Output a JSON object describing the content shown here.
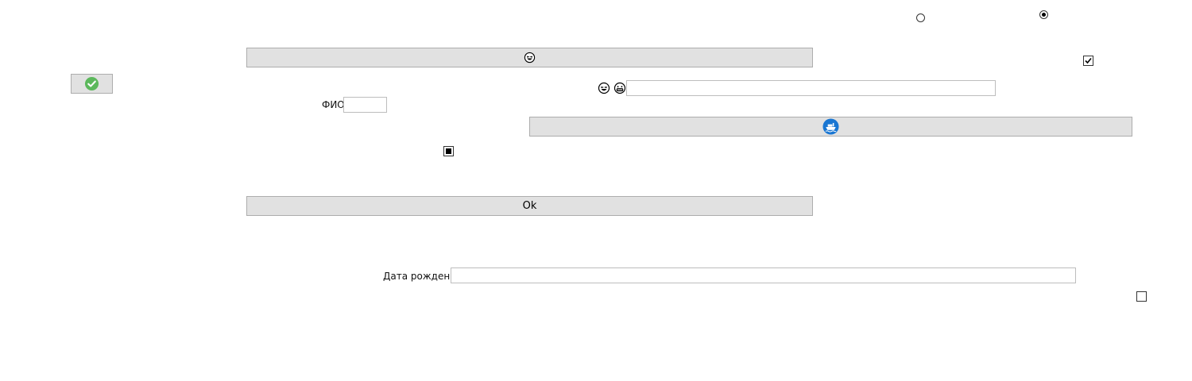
{
  "radio_group": {
    "options": [
      {
        "name": "radio-option-1",
        "selected": false
      },
      {
        "name": "radio-option-2",
        "selected": true
      }
    ]
  },
  "checkboxes": {
    "top_right": {
      "checked": true
    },
    "indeterminate": {
      "state": "indeterminate"
    },
    "bottom_right": {
      "checked": false
    }
  },
  "buttons": {
    "emoji_button": {
      "icon": "laughing-emoji-icon",
      "label": ""
    },
    "check_button": {
      "icon": "green-checkmark-icon",
      "label": ""
    },
    "ship_button": {
      "icon": "ship-icon",
      "label": ""
    },
    "ok_button": {
      "label": "Ok"
    }
  },
  "emoji_row": {
    "icons": [
      "laughing-emoji-icon",
      "grinning-emoji-icon"
    ],
    "input_value": ""
  },
  "fio": {
    "label": "ФИО",
    "value": ""
  },
  "birth_date": {
    "label": "Дата рождения",
    "value": ""
  }
}
